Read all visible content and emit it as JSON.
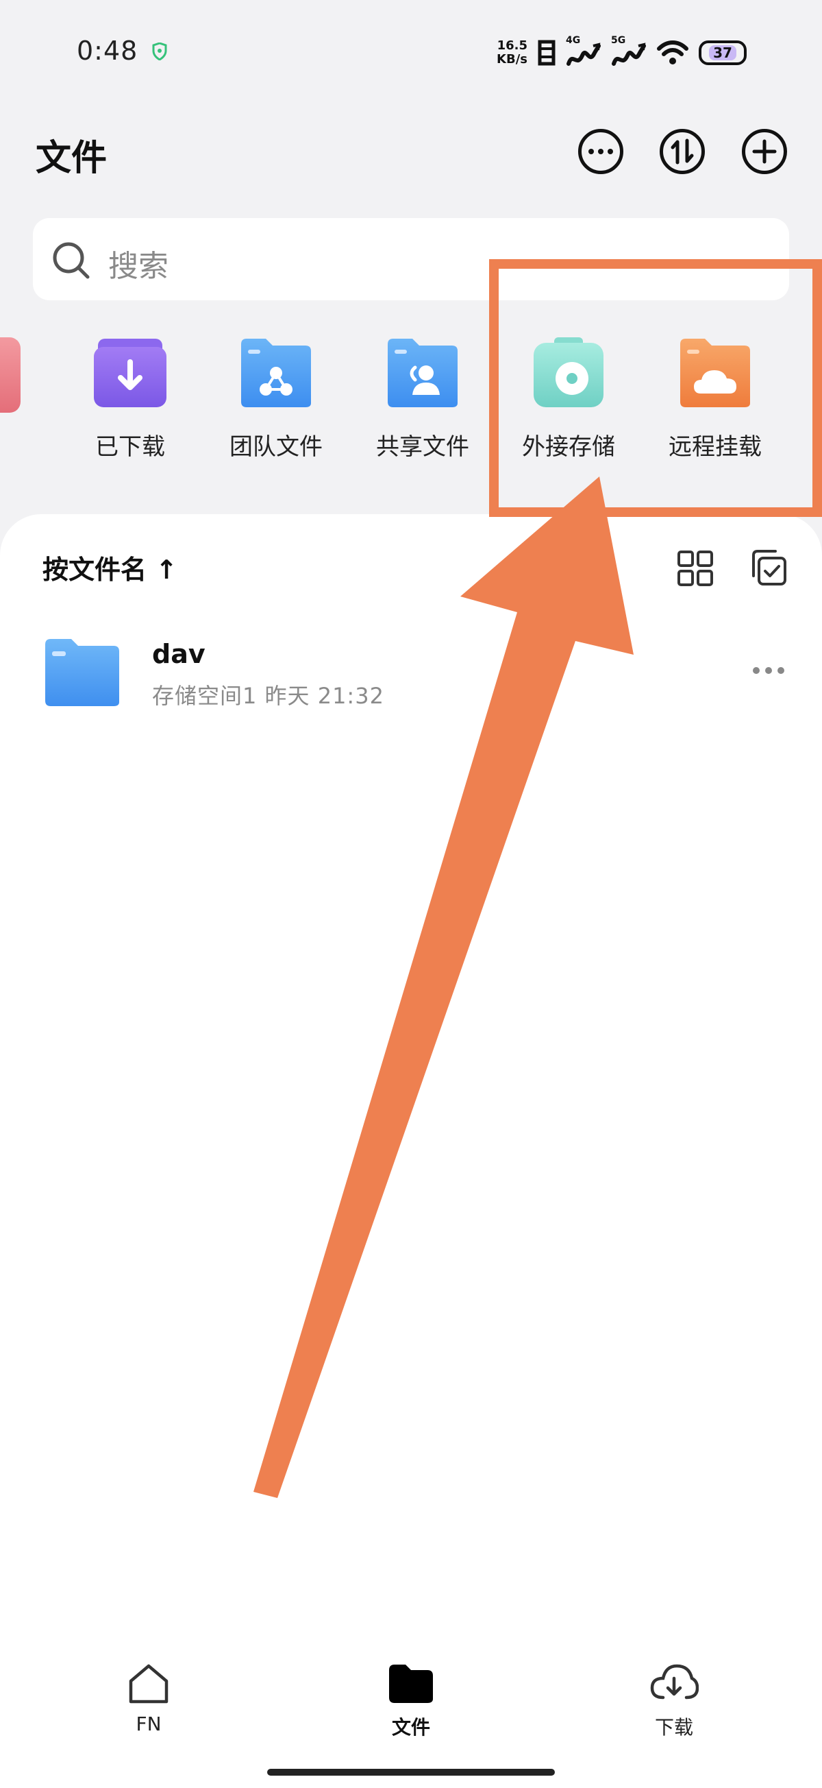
{
  "status": {
    "time": "0:48",
    "net_speed_value": "16.5",
    "net_speed_unit": "KB/s",
    "signal1_label": "4G",
    "signal2_label": "5G",
    "battery": "37"
  },
  "header": {
    "title": "文件"
  },
  "search": {
    "placeholder": "搜索"
  },
  "shortcuts": [
    {
      "label": "已下载",
      "icon": "download-folder-icon"
    },
    {
      "label": "团队文件",
      "icon": "team-folder-icon"
    },
    {
      "label": "共享文件",
      "icon": "shared-folder-icon"
    },
    {
      "label": "外接存储",
      "icon": "external-storage-icon"
    },
    {
      "label": "远程挂载",
      "icon": "remote-mount-icon"
    }
  ],
  "list": {
    "sort_label": "按文件名 ↑",
    "files": [
      {
        "name": "dav",
        "meta": "存储空间1 昨天 21:32",
        "icon": "folder-icon"
      }
    ]
  },
  "bottom_nav": [
    {
      "label": "FN",
      "icon": "home-icon"
    },
    {
      "label": "文件",
      "icon": "folder-icon"
    },
    {
      "label": "下载",
      "icon": "cloud-download-icon"
    }
  ],
  "colors": {
    "annotation": "#ee8050",
    "background": "#f2f2f4",
    "folder_blue": "#4a9cf0"
  }
}
